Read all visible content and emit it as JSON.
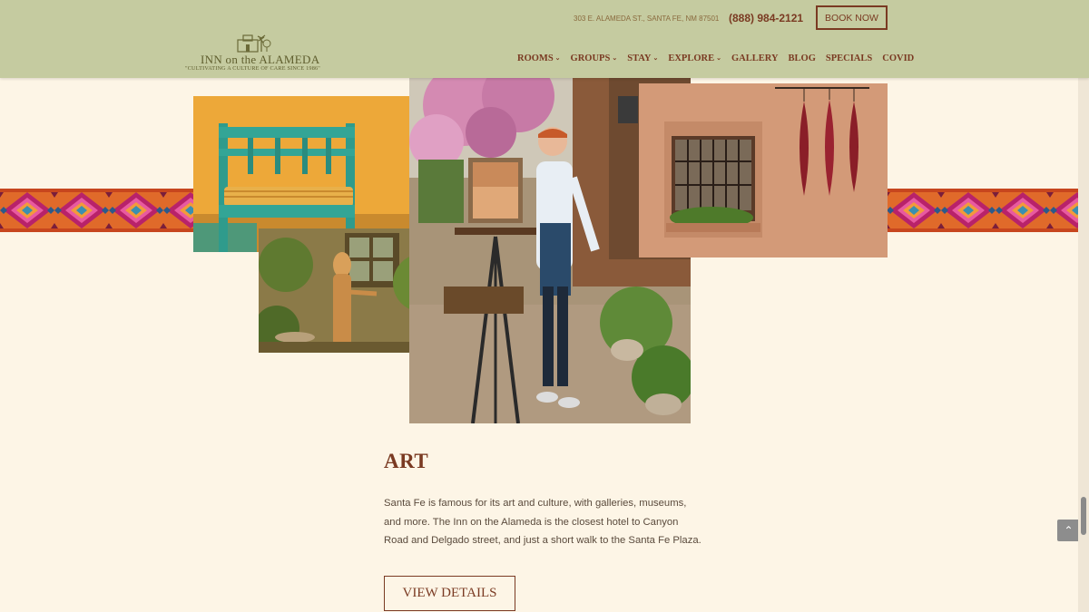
{
  "header": {
    "logo_name": "INN on the ALAMEDA",
    "logo_tagline": "\"CULTIVATING A CULTURE OF CARE SINCE 1986\"",
    "address": "303 E. ALAMEDA ST., SANTA FE, NM 87501",
    "phone": "(888) 984-2121",
    "book_label": "BOOK NOW",
    "nav": [
      {
        "label": "ROOMS",
        "dropdown": true
      },
      {
        "label": "GROUPS",
        "dropdown": true
      },
      {
        "label": "STAY",
        "dropdown": true
      },
      {
        "label": "EXPLORE",
        "dropdown": true
      },
      {
        "label": "GALLERY",
        "dropdown": false
      },
      {
        "label": "BLOG",
        "dropdown": false
      },
      {
        "label": "SPECIALS",
        "dropdown": false
      },
      {
        "label": "COVID",
        "dropdown": false
      }
    ]
  },
  "section": {
    "heading": "ART",
    "body": "Santa Fe is famous for its art and culture, with galleries, museums, and more. The Inn on the Alameda is the closest hotel to Canyon Road and Delgado street, and just a short walk to the Santa Fe Plaza.",
    "button_label": "VIEW DETAILS"
  },
  "colors": {
    "header_bg": "#c5cba0",
    "page_bg": "#fdf5e6",
    "accent": "#7a3a22"
  },
  "icons": {
    "caret": "chevron-down-icon",
    "to_top": "chevron-up-icon"
  }
}
